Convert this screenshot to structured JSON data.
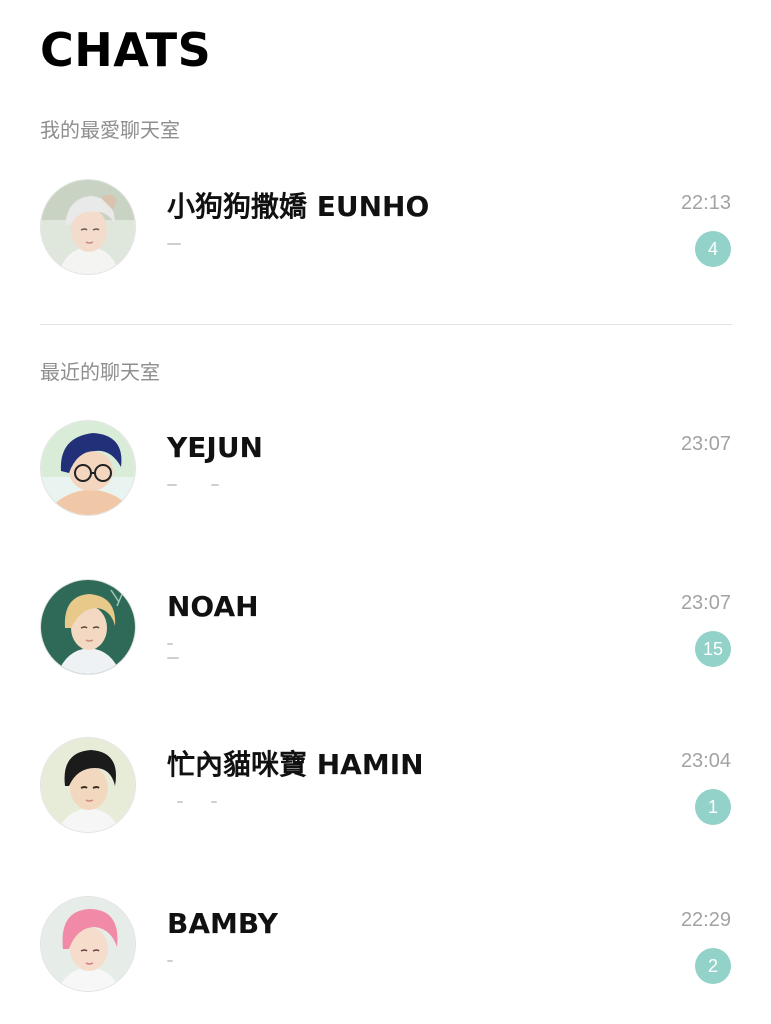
{
  "header": {
    "title": "CHATS"
  },
  "sections": {
    "favorites_label": "我的最愛聊天室",
    "recent_label": "最近的聊天室"
  },
  "favorites": [
    {
      "name": "小狗狗撒嬌 EUNHO",
      "time": "22:13",
      "unread": "4",
      "avatar_theme": "silver-hair"
    }
  ],
  "recent": [
    {
      "name": "YEJUN",
      "time": "23:07",
      "unread": "",
      "avatar_theme": "navy-hair-glasses"
    },
    {
      "name": "NOAH",
      "time": "23:07",
      "unread": "15",
      "avatar_theme": "blond-hair"
    },
    {
      "name": "忙內貓咪寶 HAMIN",
      "time": "23:04",
      "unread": "1",
      "avatar_theme": "black-hair"
    },
    {
      "name": "BAMBY",
      "time": "22:29",
      "unread": "2",
      "avatar_theme": "pink-hair"
    }
  ],
  "colors": {
    "badge": "#93d2c8",
    "time": "#a3a3a3",
    "section_header": "#8e8e8e"
  }
}
